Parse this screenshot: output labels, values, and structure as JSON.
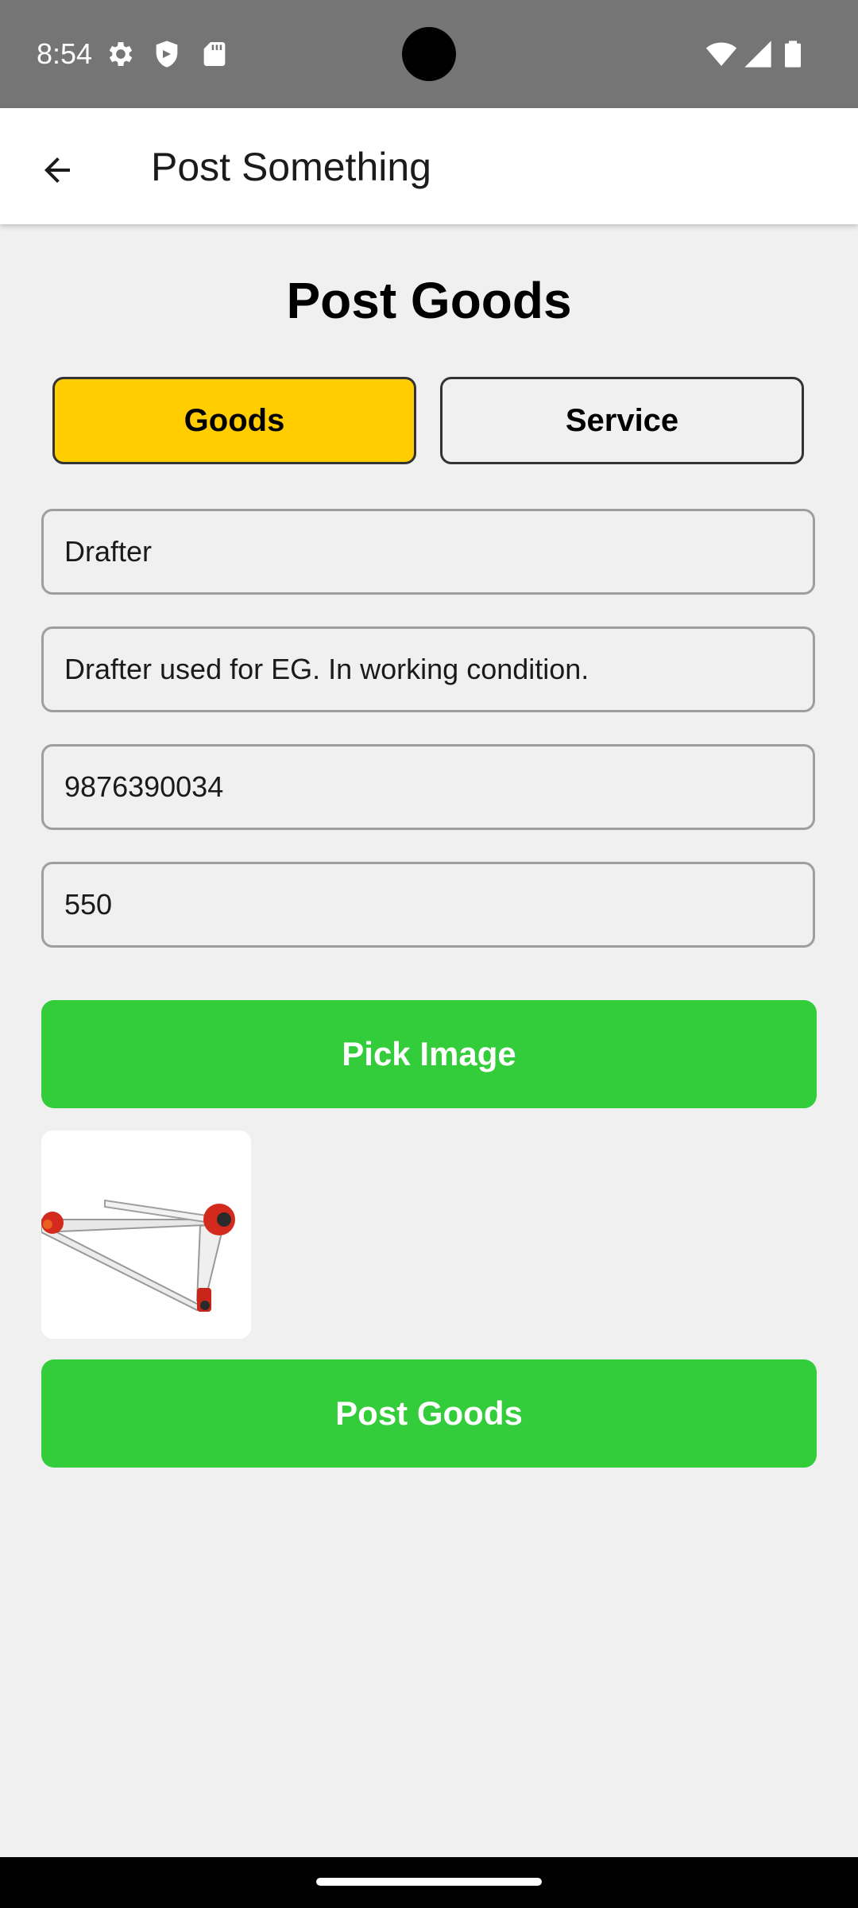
{
  "status_bar": {
    "time": "8:54",
    "left_icons": [
      "gear-icon",
      "shield-icon",
      "sd-card-icon"
    ],
    "right_icons": [
      "wifi-icon",
      "signal-icon",
      "battery-icon"
    ]
  },
  "app_bar": {
    "title": "Post Something",
    "back_icon": "arrow-back-icon"
  },
  "main": {
    "heading": "Post Goods",
    "toggle": {
      "goods_label": "Goods",
      "service_label": "Service",
      "selected": "Goods"
    },
    "fields": {
      "title_value": "Drafter",
      "description_value": "Drafter used for EG. In working condition.",
      "phone_value": "9876390034",
      "price_value": "550"
    },
    "pick_image_label": "Pick Image",
    "thumbnail_icon": "drafter-image",
    "post_button_label": "Post Goods"
  },
  "colors": {
    "status_bar": "#757575",
    "toggle_active": "#ffcd00",
    "button_green": "#33cc3a",
    "background": "#f0f0f0"
  }
}
